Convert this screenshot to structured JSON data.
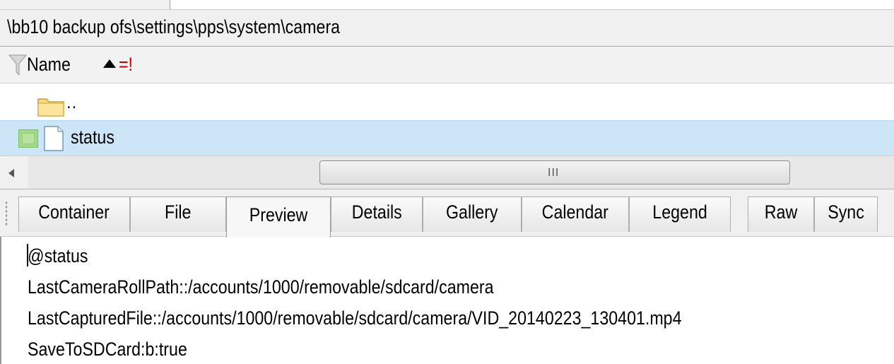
{
  "path": "\\bb10 backup ofs\\settings\\pps\\system\\camera",
  "list": {
    "header": {
      "name_label": "Name",
      "flag_text": "=!"
    },
    "rows": [
      {
        "label": "..",
        "icon": "folder-icon"
      },
      {
        "label": "status",
        "icon": "document-icon",
        "selected": true
      }
    ]
  },
  "scrollbar": {
    "grip_text": "III"
  },
  "tabs": [
    {
      "label": "Container"
    },
    {
      "label": "File"
    },
    {
      "label": "Preview",
      "active": true
    },
    {
      "label": "Details"
    },
    {
      "label": "Gallery"
    },
    {
      "label": "Calendar"
    },
    {
      "label": "Legend"
    },
    {
      "label": "Raw"
    },
    {
      "label": "Sync"
    }
  ],
  "preview": {
    "lines": [
      "@status",
      "LastCameraRollPath::/accounts/1000/removable/sdcard/camera",
      "LastCapturedFile::/accounts/1000/removable/sdcard/camera/VID_20140223_130401.mp4",
      "SaveToSDCard:b:true"
    ]
  },
  "colors": {
    "selection": "#cde6f7",
    "flag": "#c00000",
    "checkbox": "#a4d98d"
  }
}
